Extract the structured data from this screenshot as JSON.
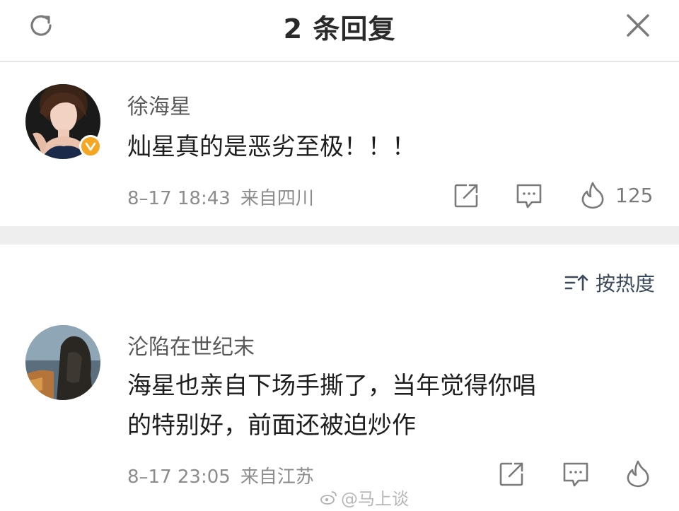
{
  "header": {
    "title": "2 条回复",
    "refresh_icon": "refresh-icon",
    "close_icon": "close-icon"
  },
  "comments": [
    {
      "username": "徐海星",
      "verified": true,
      "text_lines": [
        "灿星真的是恶劣至极！！！"
      ],
      "time": "8–17 18:43",
      "location": "来自四川",
      "likes": "125"
    },
    {
      "username": "沦陷在世纪末",
      "verified": false,
      "text_lines": [
        "海星也亲自下场手撕了，当年觉得你唱",
        "的特别好，前面还被迫炒作"
      ],
      "time": "8–17 23:05",
      "location": "来自江苏",
      "likes": ""
    }
  ],
  "sort": {
    "label": "按热度",
    "icon": "sort-icon"
  },
  "watermark": {
    "text": "@马上谈"
  },
  "colors": {
    "verified_badge": "#f5a623",
    "divider": "#eeeeee",
    "meta_text": "#8c8c8c"
  }
}
